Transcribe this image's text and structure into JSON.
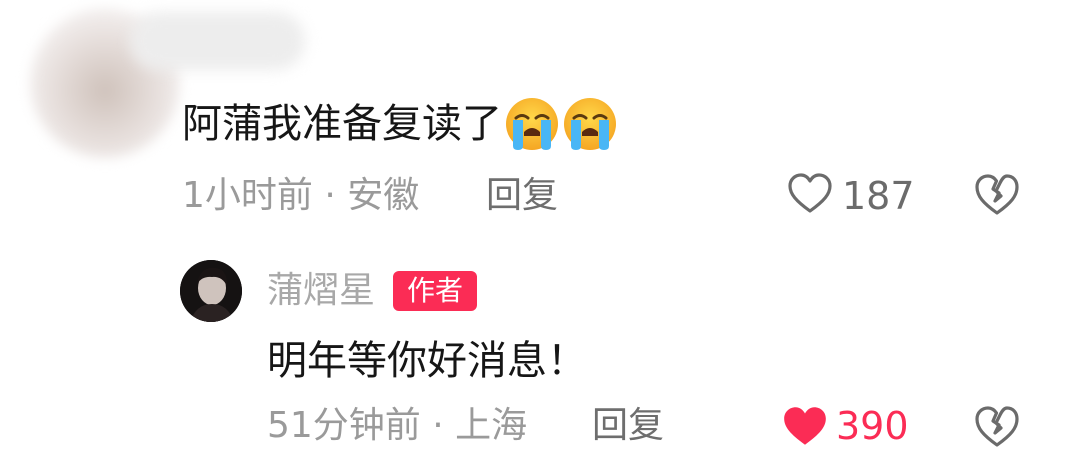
{
  "comment": {
    "text": "阿蒲我准备复读了",
    "emojis": [
      "crying-face",
      "crying-face"
    ],
    "time_location": "1小时前 · 安徽",
    "reply_label": "回复",
    "like_count": "187",
    "liked": false
  },
  "reply": {
    "author_name": "蒲熠星",
    "badge": "作者",
    "text": "明年等你好消息！",
    "time_location": "51分钟前 · 上海",
    "reply_label": "回复",
    "like_count": "390",
    "liked": true
  },
  "colors": {
    "accent": "#fb2c55",
    "muted_text": "#9a9a9a",
    "primary_text": "#161616"
  },
  "icons": [
    "heart-outline-icon",
    "broken-heart-icon",
    "heart-filled-icon",
    "crying-face-emoji"
  ]
}
